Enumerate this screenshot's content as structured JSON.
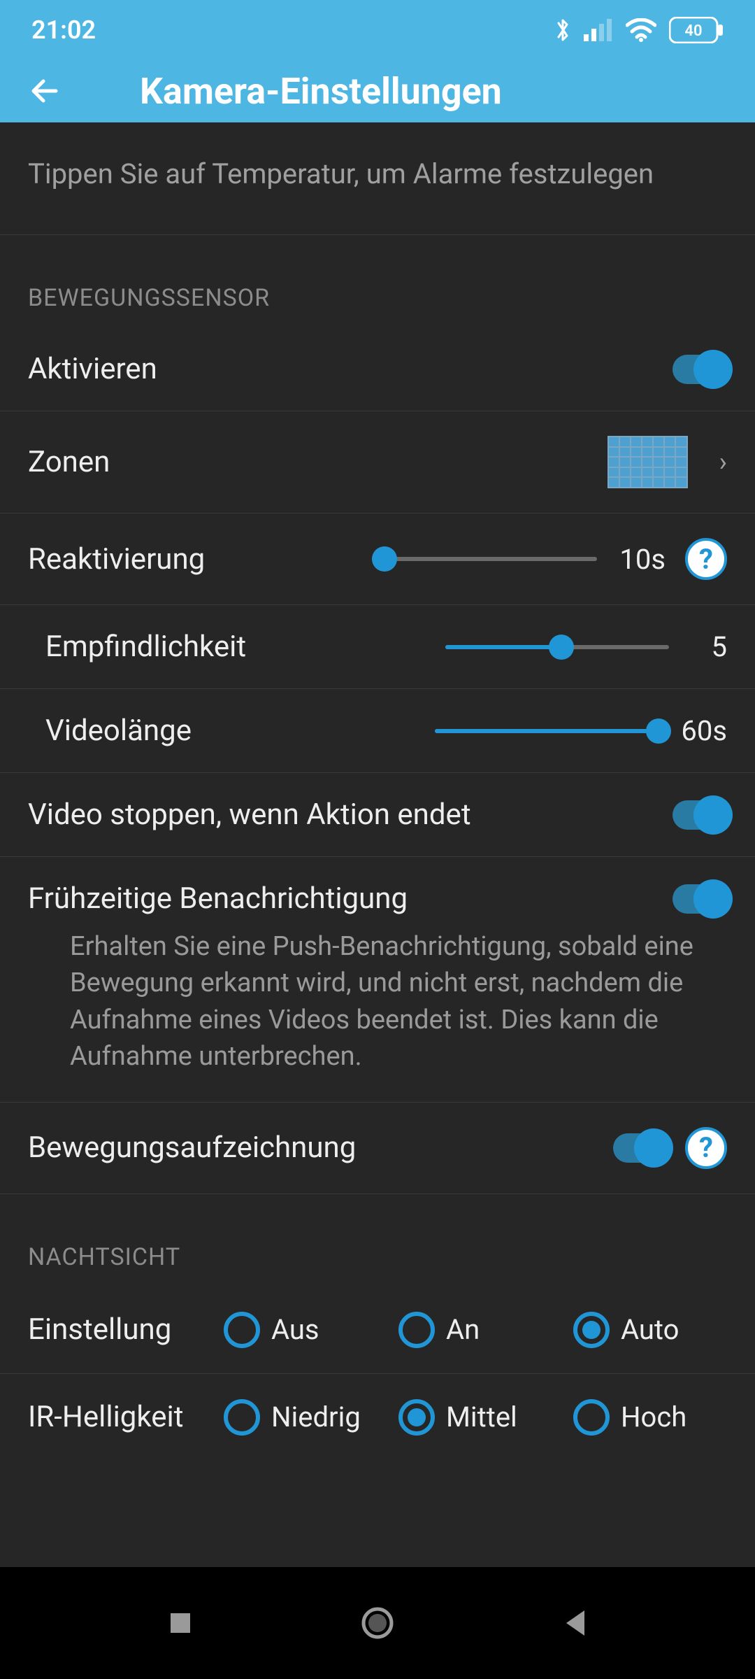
{
  "status": {
    "time": "21:02",
    "battery": "40"
  },
  "appbar": {
    "title": "Kamera-Einstellungen"
  },
  "hint": "Tippen Sie auf Temperatur, um Alarme festzulegen",
  "sections": {
    "motion": {
      "header": "BEWEGUNGSSENSOR",
      "activate": {
        "label": "Aktivieren"
      },
      "zones": {
        "label": "Zonen"
      },
      "reactivation": {
        "label": "Reaktivierung",
        "value": "10s"
      },
      "sensitivity": {
        "label": "Empfindlichkeit",
        "value": "5"
      },
      "videolength": {
        "label": "Videolänge",
        "value": "60s"
      },
      "stopvideo": {
        "label": "Video stoppen, wenn Aktion endet"
      },
      "earlynotif": {
        "label": "Frühzeitige Benachrichtigung",
        "desc": "Erhalten Sie eine Push-Benachrichtigung, sobald eine Bewegung erkannt wird, und nicht erst, nachdem die Aufnahme eines Videos beendet ist. Dies kann die Aufnahme unterbrechen."
      },
      "motionrec": {
        "label": "Bewegungsaufzeichnung"
      }
    },
    "nightvision": {
      "header": "NACHTSICHT",
      "setting": {
        "label": "Einstellung",
        "opts": [
          "Aus",
          "An",
          "Auto"
        ]
      },
      "ir": {
        "label": "IR-Helligkeit",
        "opts": [
          "Niedrig",
          "Mittel",
          "Hoch"
        ]
      }
    }
  },
  "help_char": "?"
}
